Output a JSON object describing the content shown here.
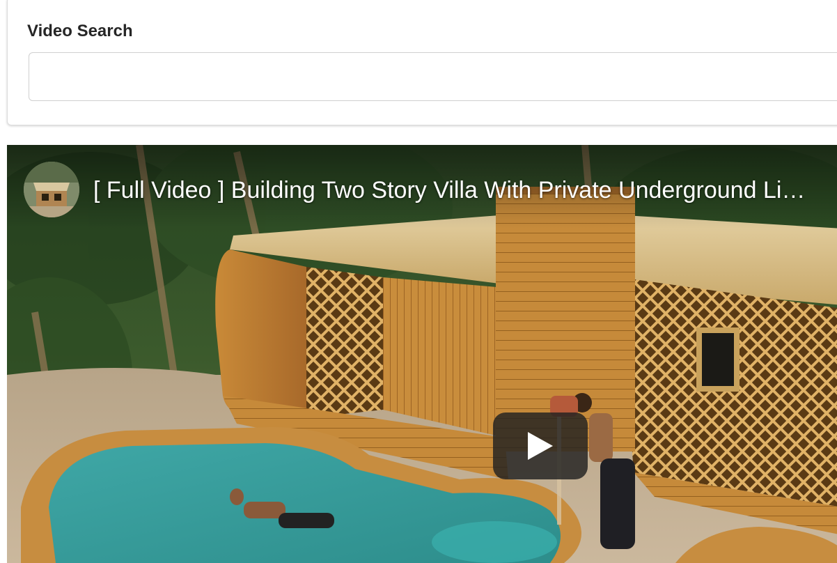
{
  "search": {
    "label": "Video Search",
    "value": "",
    "placeholder": ""
  },
  "video": {
    "title": "[ Full Video ] Building Two Story Villa With Private Underground Li…",
    "channel_avatar_icon": "channel-avatar",
    "play_icon": "play-icon"
  },
  "colors": {
    "card_border": "#dcdcdc",
    "play_button_bg": "#212121",
    "title_text": "#ffffff"
  }
}
